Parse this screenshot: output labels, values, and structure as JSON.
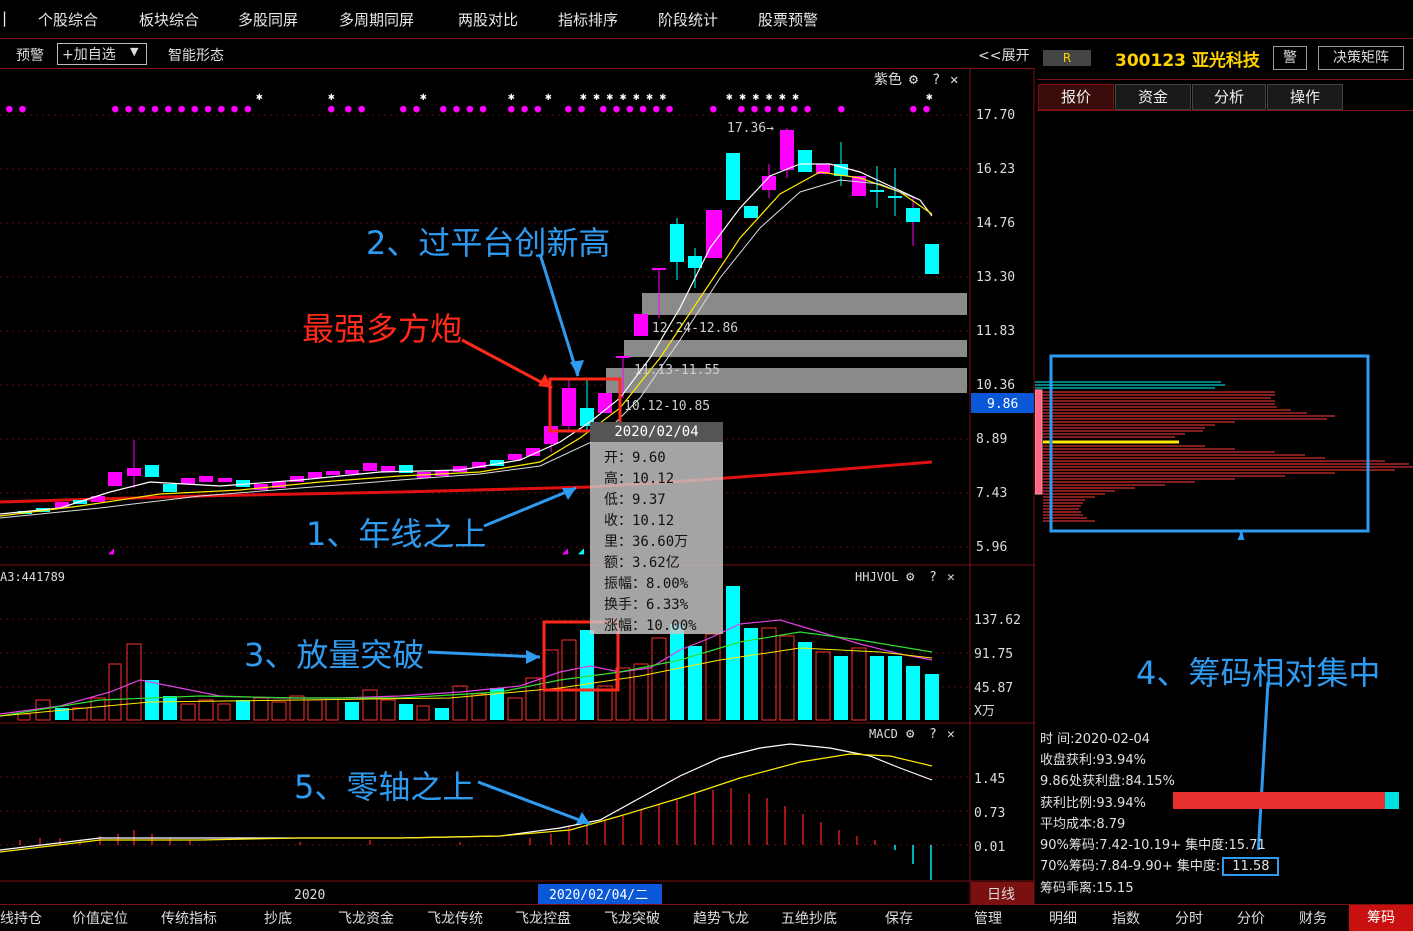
{
  "top_menu": [
    "个股综合",
    "板块综合",
    "多股同屏",
    "多周期同屏",
    "两股对比",
    "指标排序",
    "阶段统计",
    "股票预警"
  ],
  "toolbar": {
    "alert": "预警",
    "add_watch": "+加自选",
    "add_watch_arrow": "▼",
    "pattern": "智能形态",
    "expand": "<<展开"
  },
  "stock": {
    "badge": "R",
    "code_name": "300123 亚光科技",
    "alarm": "警",
    "matrix": "决策矩阵"
  },
  "right_tabs": [
    "报价",
    "资金",
    "分析",
    "操作"
  ],
  "price_axis": [
    "17.70",
    "16.23",
    "14.76",
    "13.30",
    "11.83",
    "10.36",
    "8.89",
    "7.43",
    "5.96"
  ],
  "current_price": "9.86",
  "main_chart": {
    "color_label": "紫色",
    "gear": "⚙",
    "help": "?",
    "close": "✕",
    "peak_label": "17.36→"
  },
  "zones": [
    "12.24-12.86",
    "11.13-11.55",
    "10.12-10.85"
  ],
  "tooltip": {
    "date": "2020/02/04",
    "open": "开：9.60",
    "high": "高：10.12",
    "low": "低：9.37",
    "close": "收：10.12",
    "volume": "里：36.60万",
    "amount": "额：3.62亿",
    "amplitude": "振幅：8.00%",
    "turnover": "换手：6.33%",
    "change": "涨幅：10.00%"
  },
  "volume_panel": {
    "label_left": "A3:441789",
    "name": "HHJVOL",
    "axis": [
      "137.62",
      "91.75",
      "45.87",
      "X万"
    ]
  },
  "macd_panel": {
    "name": "MACD",
    "axis": [
      "1.45",
      "0.73",
      "0.01"
    ]
  },
  "time_axis": {
    "year": "2020",
    "cursor": "2020/02/04/二",
    "period": "日线"
  },
  "annotations": {
    "a1": "1、年线之上",
    "a2": "2、过平台创新高",
    "a3": "3、放量突破",
    "a4": "4、筹码相对集中",
    "a5": "5、零轴之上",
    "strongest": "最强多方炮"
  },
  "chip_info": {
    "time": "时      间:2020-02-04",
    "close_profit": "收盘获利:93.94%",
    "profit_at": "9.86处获利盘:84.15%",
    "profit_ratio": "获利比例:93.94%",
    "avg_cost": "平均成本:8.79",
    "chip90": "90%筹码:7.42-10.19+ 集中度:15.71",
    "chip70_prefix": "70%筹码:7.84-9.90+ 集中度:",
    "chip70_value": "11.58",
    "chip_dist": "筹码乖离:15.15"
  },
  "bottom_tabs": [
    "线持仓",
    "价值定位",
    "传统指标",
    "抄底",
    "飞龙资金",
    "飞龙传统",
    "飞龙控盘",
    "飞龙突破",
    "趋势飞龙",
    "五绝抄底",
    "保存",
    "管理"
  ],
  "bottom_right_tabs": [
    "明细",
    "指数",
    "分时",
    "分价",
    "财务",
    "筹码"
  ],
  "colors": {
    "up": "#ff00ff",
    "down": "#00ffff",
    "annot_blue": "#2f9bf0",
    "annot_red": "#ff2a1a",
    "year_line": "#e01010"
  }
}
